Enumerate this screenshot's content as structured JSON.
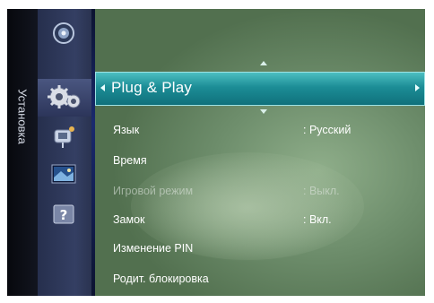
{
  "sidebar": {
    "section_label": "Установка",
    "icons": [
      "speaker-icon",
      "gear-icon",
      "satellite-icon",
      "picture-icon",
      "help-icon"
    ],
    "help_glyph": "?"
  },
  "menu": {
    "highlighted": "Plug & Play",
    "items": [
      {
        "label": "Язык",
        "value": ": Русский",
        "enabled": true
      },
      {
        "label": "Время",
        "value": "",
        "enabled": true
      },
      {
        "label": "Игровой режим",
        "value": ": Выкл.",
        "enabled": false
      },
      {
        "label": "Замок",
        "value": ": Вкл.",
        "enabled": true
      },
      {
        "label": "Изменение PIN",
        "value": "",
        "enabled": true
      },
      {
        "label": "Родит. блокировка",
        "value": "",
        "enabled": true
      }
    ]
  },
  "colors": {
    "highlight": "#1c8d96",
    "panel": "#343f63",
    "background": "#6e8e6c"
  }
}
